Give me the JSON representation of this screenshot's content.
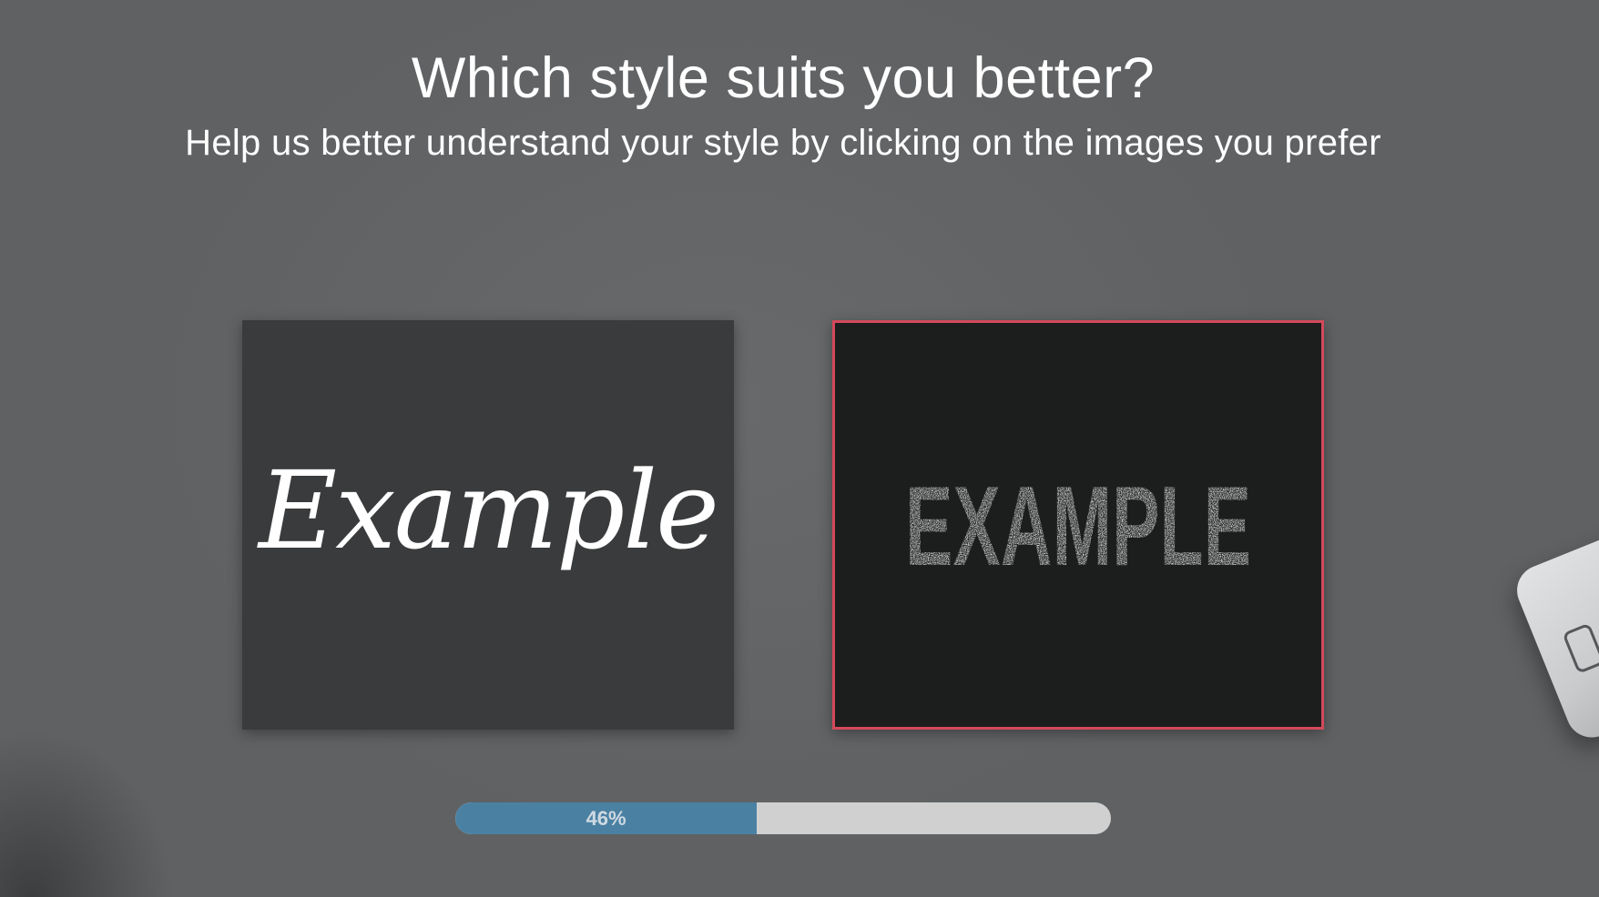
{
  "header": {
    "title": "Which style suits you better?",
    "subtitle": "Help us better understand your style by clicking on the images you prefer"
  },
  "options": [
    {
      "text": "Example",
      "style": "script",
      "selected": false
    },
    {
      "text": "EXAMPLE",
      "style": "distressed-bold",
      "selected": true
    }
  ],
  "progress": {
    "label": "46%",
    "value": 0.46
  },
  "colors": {
    "background": "#5f6163",
    "selected_border": "#d3495a",
    "progress_fill": "#4a81a3",
    "progress_track": "#cfd0cf"
  }
}
